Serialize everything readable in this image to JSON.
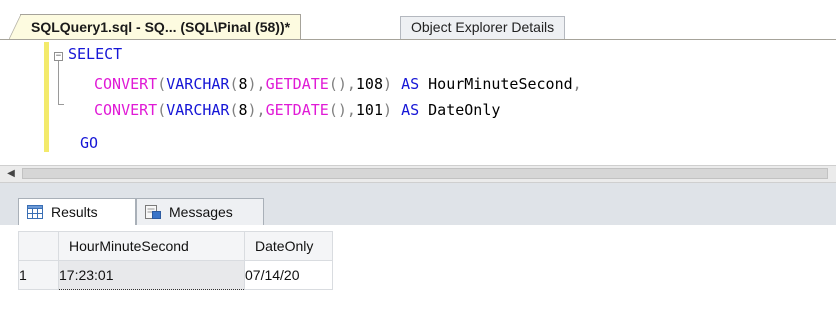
{
  "document_tabs": [
    {
      "label": "SQLQuery1.sql - SQ... (SQL\\Pinal (58))*",
      "active": true
    },
    {
      "label": "Object Explorer Details",
      "active": false
    }
  ],
  "editor": {
    "fold_glyph": "−",
    "lines": {
      "l1": {
        "kw": "SELECT"
      },
      "l2": {
        "fn1": "CONVERT",
        "p1": "(",
        "kw1": "VARCHAR",
        "p2": "(",
        "num": "8",
        "p3": "),",
        "fn2": "GETDATE",
        "p4": "(),",
        "style": "108",
        "p5": ")",
        "kw2": "AS",
        "alias": "HourMinuteSecond",
        "comma": ","
      },
      "l3": {
        "fn1": "CONVERT",
        "p1": "(",
        "kw1": "VARCHAR",
        "p2": "(",
        "num": "8",
        "p3": "),",
        "fn2": "GETDATE",
        "p4": "(),",
        "style": "101",
        "p5": ")",
        "kw2": "AS",
        "alias": "DateOnly"
      },
      "l4": {
        "go": "GO"
      }
    }
  },
  "results_pane": {
    "tabs": [
      {
        "label": "Results",
        "icon": "grid-icon",
        "active": true
      },
      {
        "label": "Messages",
        "icon": "messages-icon",
        "active": false
      }
    ],
    "columns": [
      "HourMinuteSecond",
      "DateOnly"
    ],
    "rows": [
      {
        "row_number": "1",
        "cells": [
          "17:23:01",
          "07/14/20"
        ]
      }
    ]
  },
  "colors": {
    "keyword": "#1616d6",
    "function": "#e01ad6",
    "operator": "#808080",
    "modified_marker": "#f3ea6b"
  }
}
